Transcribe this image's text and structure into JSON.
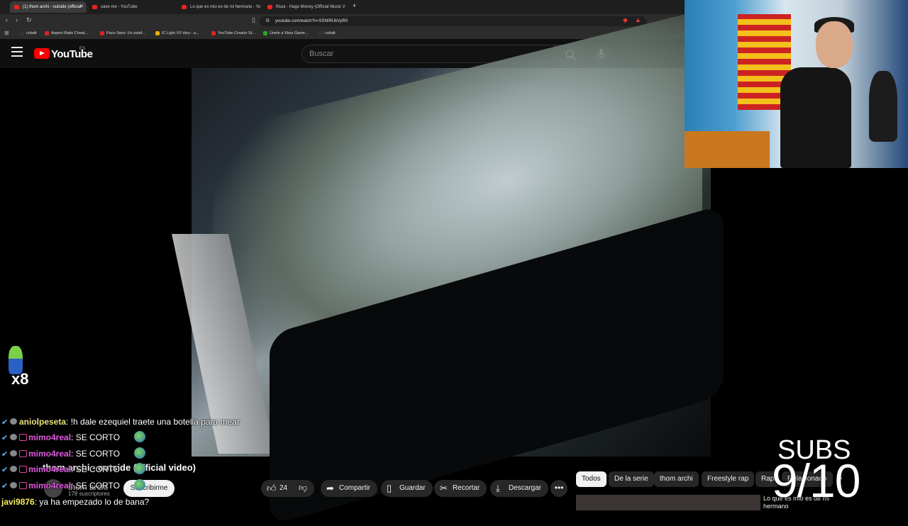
{
  "browser": {
    "tabs": [
      {
        "title": "(1) thom archi - outside (official"
      },
      {
        "title": "save me - YouTube"
      },
      {
        "title": "Lo que es mio es de mi hermano - Yo"
      },
      {
        "title": "Kluui - Hago Money (Official Music V"
      }
    ],
    "new_tab": "+",
    "url": "youtube.com/watch?v=SSNIRUkVpR0",
    "bookmarks": [
      {
        "label": "cobalt",
        "color": "#333"
      },
      {
        "label": "Aspect Ratio Cheat...",
        "color": "#d22"
      },
      {
        "label": "Paco Sanz: Un estaf...",
        "color": "#d22"
      },
      {
        "label": "IC Light V2-Vary - a...",
        "color": "#e8b100"
      },
      {
        "label": "YouTube Creator St...",
        "color": "#d22"
      },
      {
        "label": "Únete a Xbox Game...",
        "color": "#2a2"
      },
      {
        "label": "cobalt",
        "color": "#333"
      }
    ]
  },
  "youtube": {
    "logo_text": "YouTube",
    "country": "ES",
    "search_placeholder": "Buscar",
    "video_title": "thom archi - outside (official video)",
    "channel": "thom archi",
    "subscribers": "178 suscriptores",
    "subscribe": "Suscribirme",
    "likes": "24",
    "share": "Compartir",
    "save": "Guardar",
    "clip": "Recortar",
    "download": "Descargar",
    "more": "•••",
    "chips": [
      "Todos",
      "De la serie",
      "thom archi",
      "Freestyle rap",
      "Rap",
      "Relacionado"
    ],
    "rec_title": "Lo que es mio es de mi hermano"
  },
  "overlay": {
    "emote_count": "x8",
    "chat": [
      {
        "user": "aniolpeseta",
        "color": "#e8e079",
        "message": "!h dale ezequiel traete una botella para mear",
        "badge": false,
        "emote": false
      },
      {
        "user": "mimo4real",
        "color": "#e05ce0",
        "message": "SE CORTO",
        "badge": true,
        "emote": true
      },
      {
        "user": "mimo4real",
        "color": "#e05ce0",
        "message": "SE CORTO",
        "badge": true,
        "emote": true
      },
      {
        "user": "mimo4real",
        "color": "#e05ce0",
        "message": "SE CORTO",
        "badge": true,
        "emote": true
      },
      {
        "user": "mimo4real",
        "color": "#e05ce0",
        "message": "SE CORTO",
        "badge": true,
        "emote": true
      },
      {
        "user": "javi9876",
        "color": "#f5ef5e",
        "message": "ya ha empezado lo de bana?",
        "badge": false,
        "emote": false
      }
    ],
    "subs_label": "SUBS",
    "subs_value": "9/10"
  }
}
